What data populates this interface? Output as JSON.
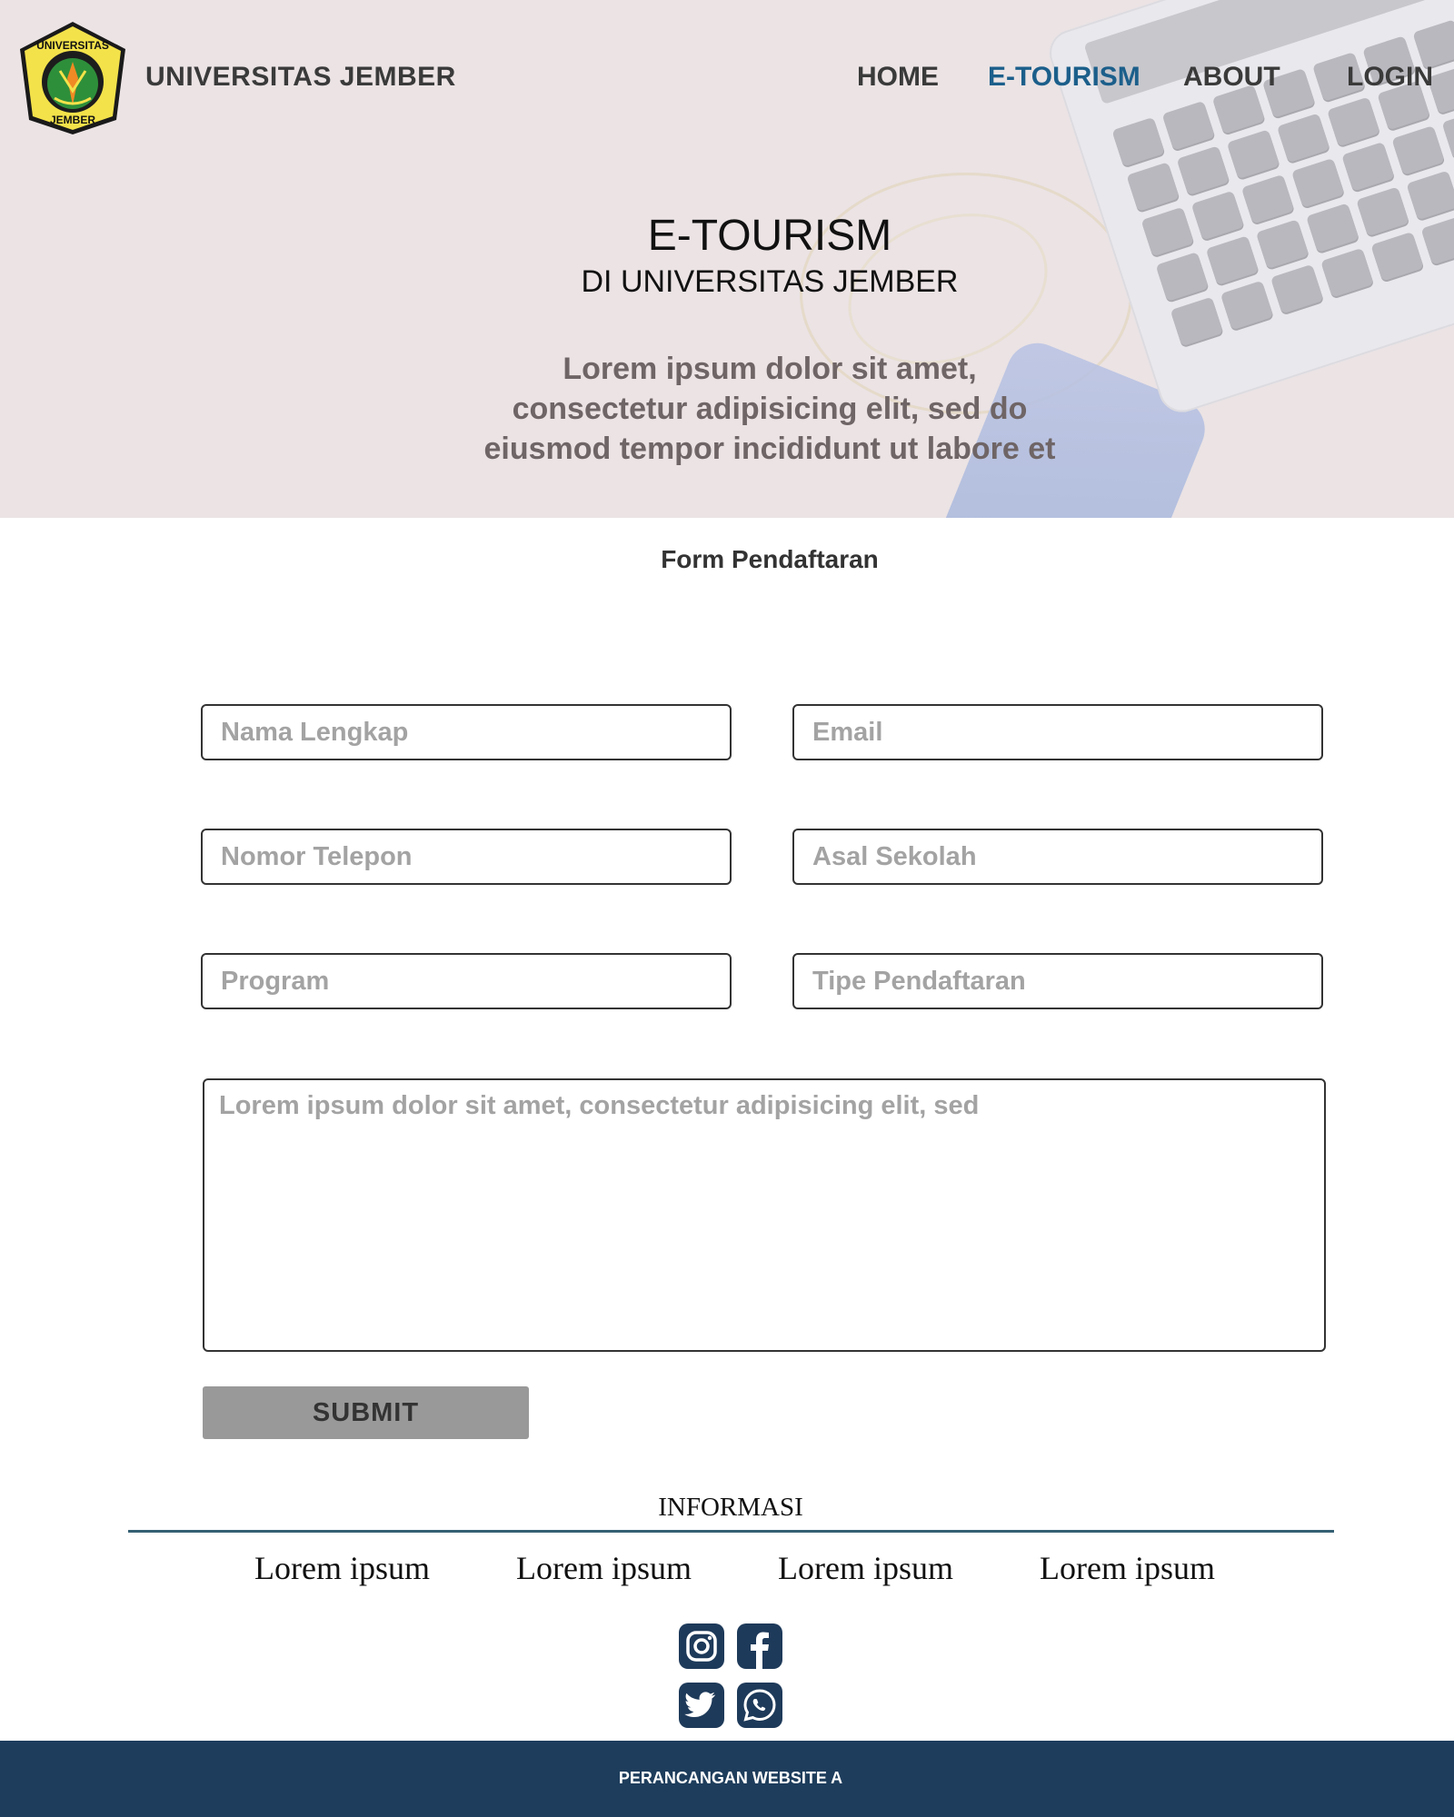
{
  "header": {
    "brand": "UNIVERSITAS JEMBER",
    "nav": [
      "HOME",
      "E-TOURISM",
      "ABOUT",
      "LOGIN"
    ],
    "active_nav": "E-TOURISM",
    "logo_text_top": "UNIVERSITAS",
    "logo_text_bottom": "JEMBER"
  },
  "hero": {
    "title": "E-TOURISM",
    "subtitle": "DI UNIVERSITAS JEMBER",
    "text_lines": [
      "Lorem ipsum dolor sit amet,",
      "consectetur adipisicing elit, sed do",
      "eiusmod tempor incididunt ut labore et"
    ]
  },
  "form": {
    "title": "Form Pendaftaran",
    "fields": {
      "nama": "Nama Lengkap",
      "email": "Email",
      "telepon": "Nomor Telepon",
      "sekolah": "Asal Sekolah",
      "program": "Program",
      "tipe": "Tipe Pendaftaran"
    },
    "message_placeholder": "Lorem ipsum dolor sit amet, consectetur adipisicing elit, sed",
    "submit": "SUBMIT"
  },
  "info": {
    "title": "INFORMASI",
    "links": [
      "Lorem ipsum",
      "Lorem ipsum",
      "Lorem ipsum",
      "Lorem ipsum"
    ]
  },
  "social": [
    "instagram-icon",
    "facebook-icon",
    "twitter-icon",
    "whatsapp-icon"
  ],
  "footer": {
    "text": "PERANCANGAN WEBSITE A"
  },
  "colors": {
    "accent": "#1c5f8b",
    "footer": "#1e3d5c",
    "social": "#1e3a5a",
    "hero_bg": "#ebe3e4",
    "button": "#999999"
  }
}
